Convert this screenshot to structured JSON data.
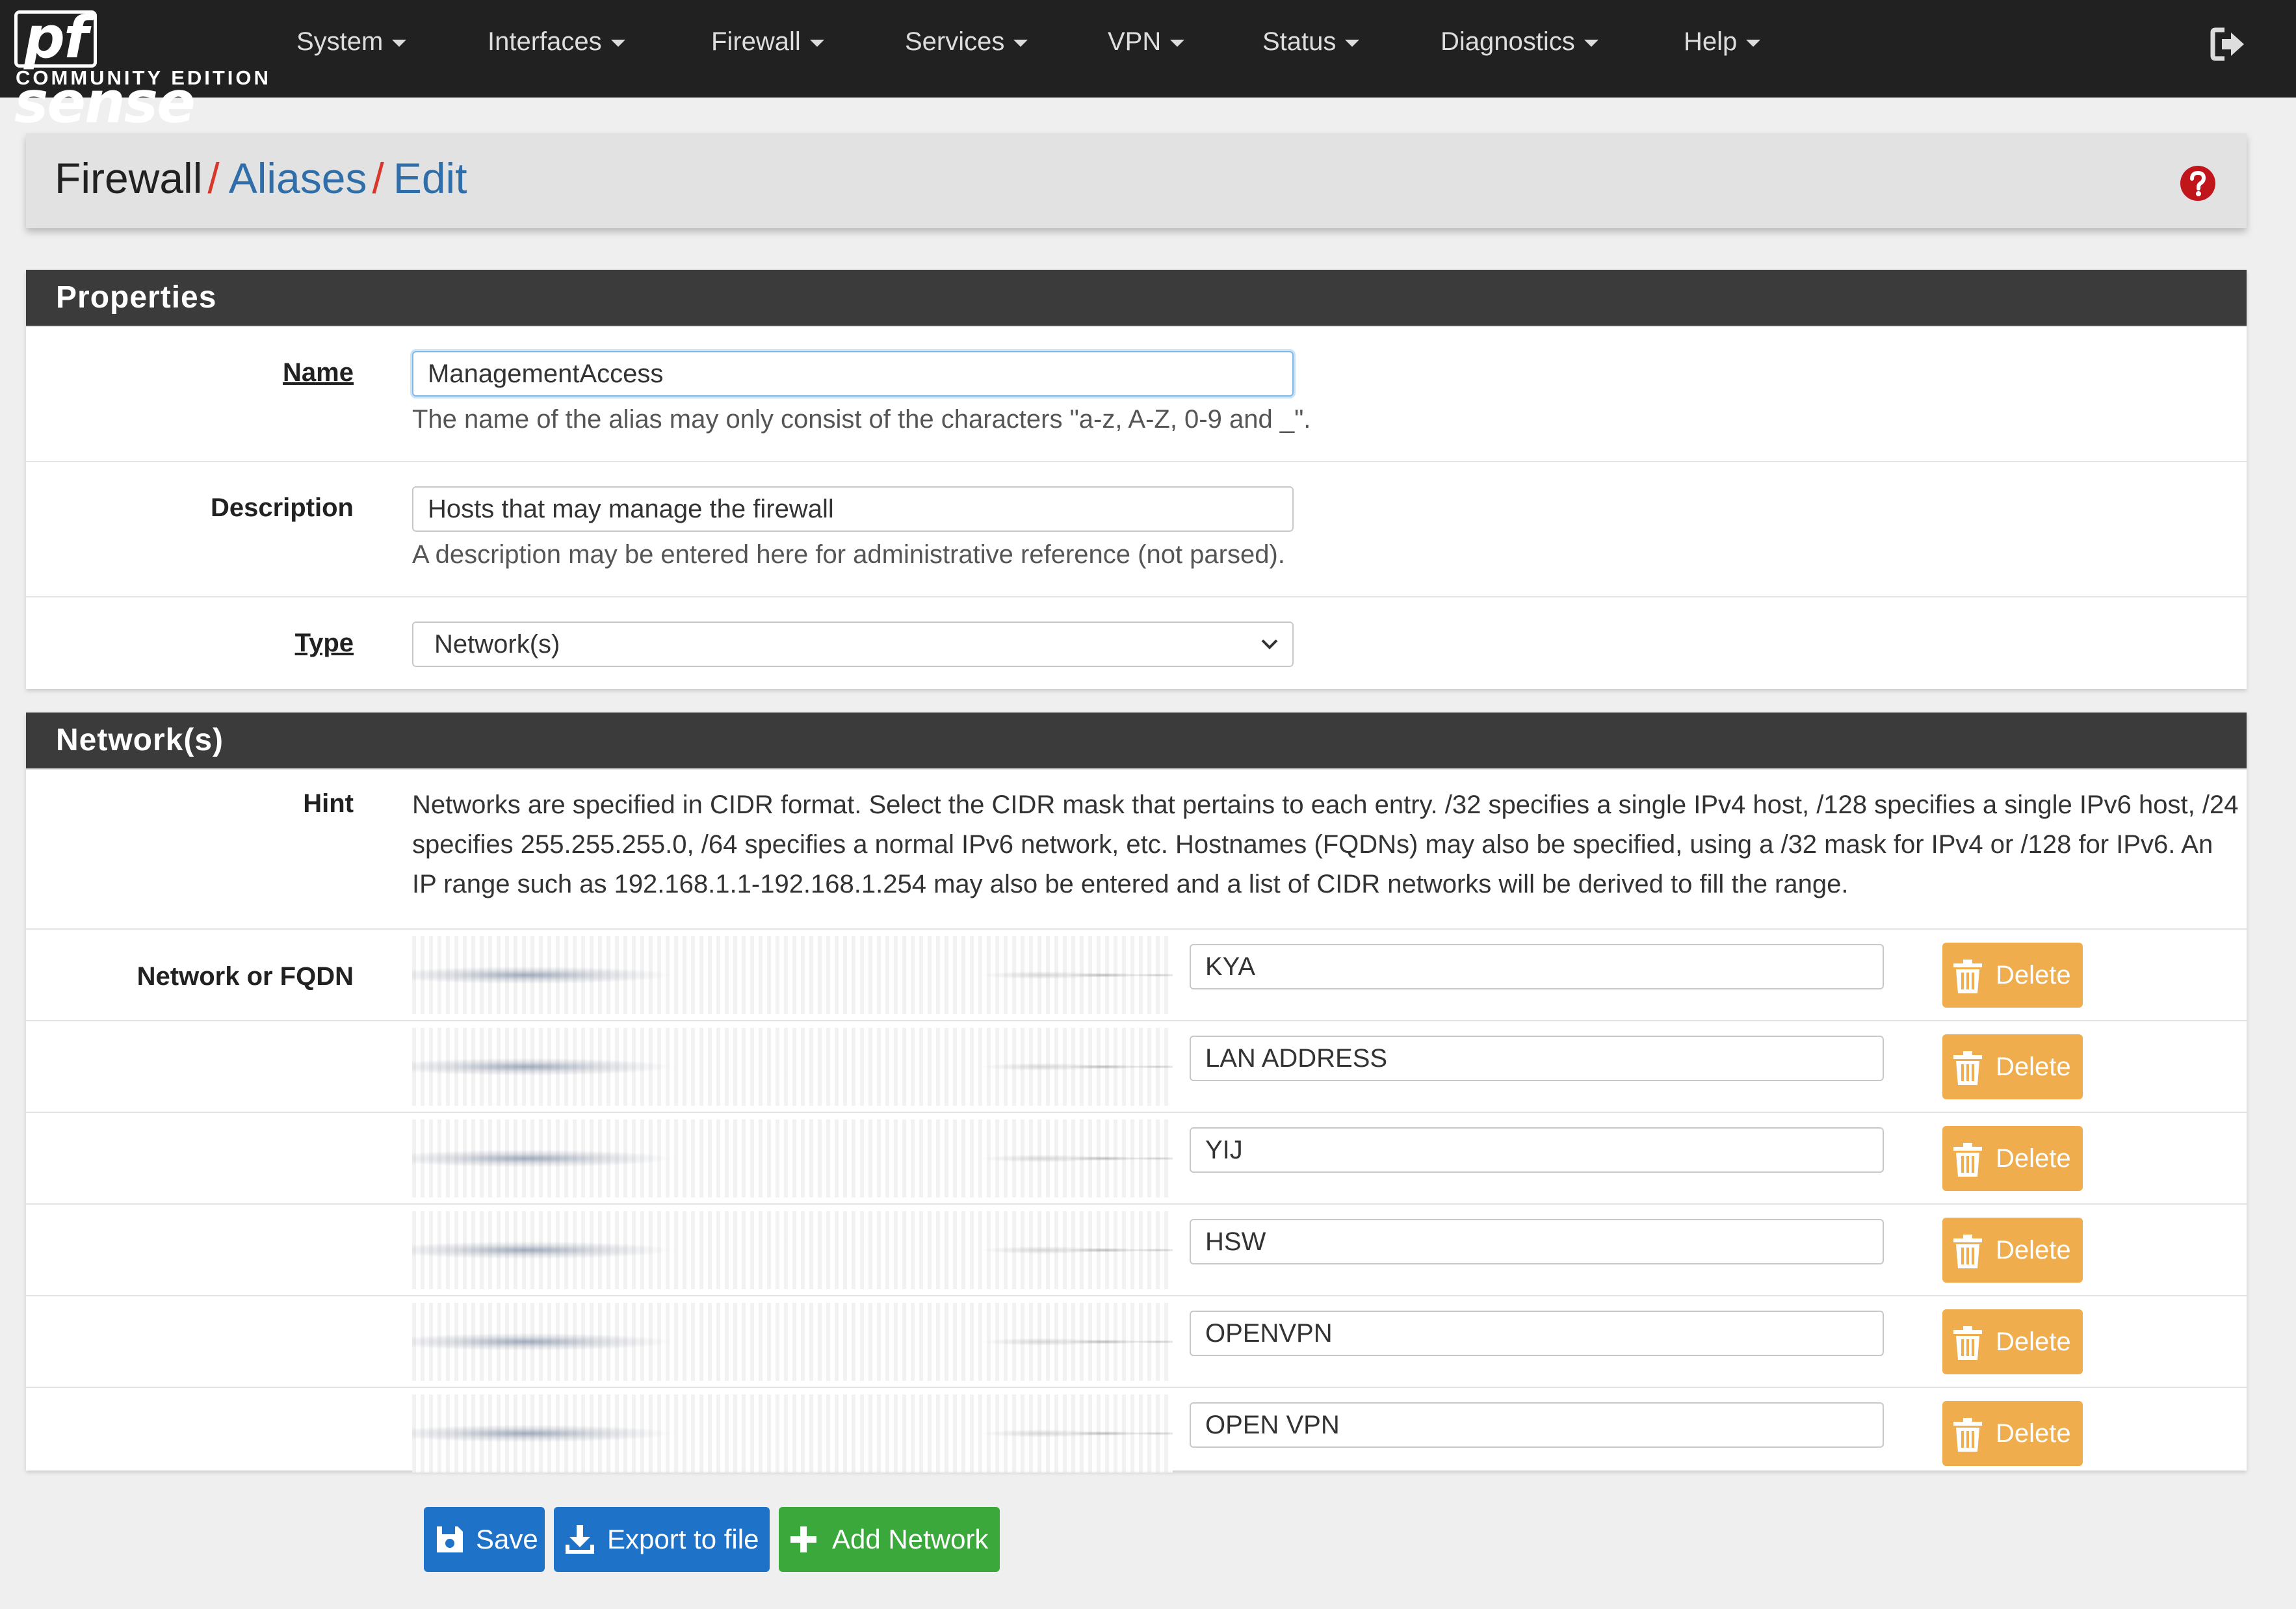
{
  "brand": {
    "logo_pf": "pf",
    "logo_sense": "sense",
    "edition": "COMMUNITY EDITION"
  },
  "nav": {
    "items": [
      "System",
      "Interfaces",
      "Firewall",
      "Services",
      "VPN",
      "Status",
      "Diagnostics",
      "Help"
    ]
  },
  "breadcrumb": {
    "root": "Firewall",
    "sep": "/",
    "level2": "Aliases",
    "level3": "Edit"
  },
  "properties": {
    "heading": "Properties",
    "name_label": "Name",
    "name_value": "ManagementAccess",
    "name_help": "The name of the alias may only consist of the characters \"a-z, A-Z, 0-9 and _\".",
    "description_label": "Description",
    "description_value": "Hosts that may manage the firewall",
    "description_help": "A description may be entered here for administrative reference (not parsed).",
    "type_label": "Type",
    "type_value": "Network(s)"
  },
  "networks": {
    "heading": "Network(s)",
    "hint_label": "Hint",
    "hint_text": "Networks are specified in CIDR format. Select the CIDR mask that pertains to each entry. /32 specifies a single IPv4 host, /128 specifies a single IPv6 host, /24 specifies 255.255.255.0, /64 specifies a normal IPv6 network, etc. Hostnames (FQDNs) may also be specified, using a /32 mask for IPv4 or /128 for IPv6. An IP range such as 192.168.1.1-192.168.1.254 may also be entered and a list of CIDR networks will be derived to fill the range.",
    "row_label": "Network or FQDN",
    "delete_label": "Delete",
    "entries": [
      {
        "description": "KYA"
      },
      {
        "description": "LAN ADDRESS"
      },
      {
        "description": "YIJ"
      },
      {
        "description": "HSW"
      },
      {
        "description": "OPENVPN"
      },
      {
        "description": "OPEN VPN"
      }
    ]
  },
  "actions": {
    "save": "Save",
    "export": "Export to file",
    "add": "Add Network"
  },
  "colors": {
    "navbar": "#212121",
    "link": "#2f6ea8",
    "danger": "#d9372b",
    "warning": "#efad4d",
    "primary": "#1e72c8",
    "success": "#3aa83a"
  }
}
